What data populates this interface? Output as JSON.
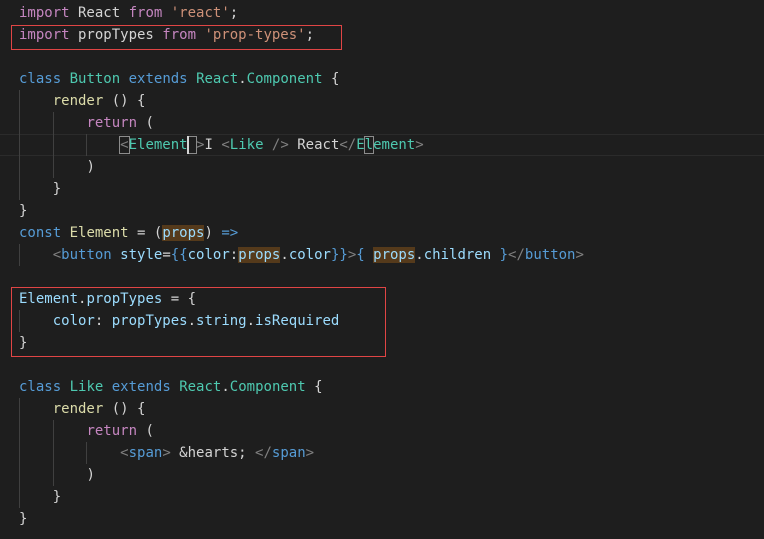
{
  "editor": {
    "lines": [
      [
        {
          "text": "import",
          "c": "ctrl"
        },
        {
          "text": " React ",
          "c": "plain"
        },
        {
          "text": "from",
          "c": "ctrl"
        },
        {
          "text": " ",
          "c": "plain"
        },
        {
          "text": "'react'",
          "c": "str"
        },
        {
          "text": ";",
          "c": "plain"
        }
      ],
      [
        {
          "text": "import",
          "c": "ctrl"
        },
        {
          "text": " propTypes ",
          "c": "plain"
        },
        {
          "text": "from",
          "c": "ctrl"
        },
        {
          "text": " ",
          "c": "plain"
        },
        {
          "text": "'prop-types'",
          "c": "str"
        },
        {
          "text": ";",
          "c": "plain"
        }
      ],
      [],
      [
        {
          "text": "class",
          "c": "kw"
        },
        {
          "text": " ",
          "c": "plain"
        },
        {
          "text": "Button",
          "c": "cls"
        },
        {
          "text": " ",
          "c": "plain"
        },
        {
          "text": "extends",
          "c": "kw"
        },
        {
          "text": " ",
          "c": "plain"
        },
        {
          "text": "React",
          "c": "cls"
        },
        {
          "text": ".",
          "c": "plain"
        },
        {
          "text": "Component",
          "c": "cls"
        },
        {
          "text": " {",
          "c": "plain"
        }
      ],
      [
        {
          "text": "    ",
          "c": "plain"
        },
        {
          "text": "render",
          "c": "fn"
        },
        {
          "text": " () {",
          "c": "plain"
        }
      ],
      [
        {
          "text": "        ",
          "c": "plain"
        },
        {
          "text": "return",
          "c": "ctrl"
        },
        {
          "text": " (",
          "c": "plain"
        }
      ],
      [
        {
          "text": "            ",
          "c": "plain"
        },
        {
          "text": "<",
          "c": "punct"
        },
        {
          "text": "Element",
          "c": "cls"
        },
        {
          "text": " ",
          "c": "plain"
        },
        {
          "text": ">",
          "c": "punct"
        },
        {
          "text": "I ",
          "c": "plain"
        },
        {
          "text": "<",
          "c": "punct"
        },
        {
          "text": "Like",
          "c": "cls"
        },
        {
          "text": " />",
          "c": "punct"
        },
        {
          "text": " React",
          "c": "plain"
        },
        {
          "text": "</",
          "c": "punct"
        },
        {
          "text": "Element",
          "c": "cls"
        },
        {
          "text": ">",
          "c": "punct"
        }
      ],
      [
        {
          "text": "        ",
          "c": "plain"
        },
        {
          "text": ")",
          "c": "plain"
        }
      ],
      [
        {
          "text": "    ",
          "c": "plain"
        },
        {
          "text": "}",
          "c": "plain"
        }
      ],
      [
        {
          "text": "}",
          "c": "plain"
        }
      ],
      [
        {
          "text": "const",
          "c": "kw"
        },
        {
          "text": " ",
          "c": "plain"
        },
        {
          "text": "Element",
          "c": "fn"
        },
        {
          "text": " = (",
          "c": "plain"
        },
        {
          "text": "props",
          "c": "var hlword"
        },
        {
          "text": ") ",
          "c": "plain"
        },
        {
          "text": "=>",
          "c": "kw"
        }
      ],
      [
        {
          "text": "    ",
          "c": "plain"
        },
        {
          "text": "<",
          "c": "punct"
        },
        {
          "text": "button",
          "c": "tag"
        },
        {
          "text": " ",
          "c": "plain"
        },
        {
          "text": "style",
          "c": "var"
        },
        {
          "text": "=",
          "c": "plain"
        },
        {
          "text": "{{",
          "c": "kw"
        },
        {
          "text": "color",
          "c": "var"
        },
        {
          "text": ":",
          "c": "plain"
        },
        {
          "text": "props",
          "c": "var hlword"
        },
        {
          "text": ".",
          "c": "plain"
        },
        {
          "text": "color",
          "c": "var"
        },
        {
          "text": "}}",
          "c": "kw"
        },
        {
          "text": ">",
          "c": "punct"
        },
        {
          "text": "{",
          "c": "kw"
        },
        {
          "text": " ",
          "c": "plain"
        },
        {
          "text": "props",
          "c": "var hlword"
        },
        {
          "text": ".",
          "c": "plain"
        },
        {
          "text": "children",
          "c": "var"
        },
        {
          "text": " ",
          "c": "plain"
        },
        {
          "text": "}",
          "c": "kw"
        },
        {
          "text": "</",
          "c": "punct"
        },
        {
          "text": "button",
          "c": "tag"
        },
        {
          "text": ">",
          "c": "punct"
        }
      ],
      [],
      [
        {
          "text": "Element",
          "c": "var"
        },
        {
          "text": ".",
          "c": "plain"
        },
        {
          "text": "propTypes",
          "c": "var"
        },
        {
          "text": " = {",
          "c": "plain"
        }
      ],
      [
        {
          "text": "    ",
          "c": "plain"
        },
        {
          "text": "color",
          "c": "var"
        },
        {
          "text": ": ",
          "c": "plain"
        },
        {
          "text": "propTypes",
          "c": "var"
        },
        {
          "text": ".",
          "c": "plain"
        },
        {
          "text": "string",
          "c": "var"
        },
        {
          "text": ".",
          "c": "plain"
        },
        {
          "text": "isRequired",
          "c": "var"
        }
      ],
      [
        {
          "text": "}",
          "c": "plain"
        }
      ],
      [],
      [
        {
          "text": "class",
          "c": "kw"
        },
        {
          "text": " ",
          "c": "plain"
        },
        {
          "text": "Like",
          "c": "cls"
        },
        {
          "text": " ",
          "c": "plain"
        },
        {
          "text": "extends",
          "c": "kw"
        },
        {
          "text": " ",
          "c": "plain"
        },
        {
          "text": "React",
          "c": "cls"
        },
        {
          "text": ".",
          "c": "plain"
        },
        {
          "text": "Component",
          "c": "cls"
        },
        {
          "text": " {",
          "c": "plain"
        }
      ],
      [
        {
          "text": "    ",
          "c": "plain"
        },
        {
          "text": "render",
          "c": "fn"
        },
        {
          "text": " () {",
          "c": "plain"
        }
      ],
      [
        {
          "text": "        ",
          "c": "plain"
        },
        {
          "text": "return",
          "c": "ctrl"
        },
        {
          "text": " (",
          "c": "plain"
        }
      ],
      [
        {
          "text": "            ",
          "c": "plain"
        },
        {
          "text": "<",
          "c": "punct"
        },
        {
          "text": "span",
          "c": "tag"
        },
        {
          "text": ">",
          "c": "punct"
        },
        {
          "text": " &hearts; ",
          "c": "plain"
        },
        {
          "text": "</",
          "c": "punct"
        },
        {
          "text": "span",
          "c": "tag"
        },
        {
          "text": ">",
          "c": "punct"
        }
      ],
      [
        {
          "text": "        ",
          "c": "plain"
        },
        {
          "text": ")",
          "c": "plain"
        }
      ],
      [
        {
          "text": "    ",
          "c": "plain"
        },
        {
          "text": "}",
          "c": "plain"
        }
      ],
      [
        {
          "text": "}",
          "c": "plain"
        }
      ]
    ],
    "colors": {
      "background": "#1e1e1e",
      "annotation_box": "#e04545",
      "word_highlight": "#553a1b"
    }
  }
}
